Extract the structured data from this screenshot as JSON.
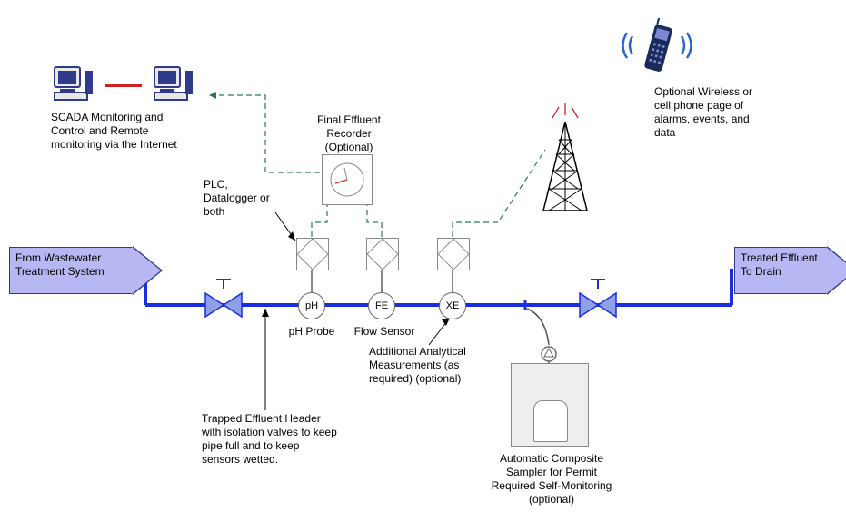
{
  "input_label": "From Wastewater\nTreatment System",
  "output_label": "Treated Effluent\nTo Drain",
  "recorder": {
    "title": "Final Effluent\nRecorder",
    "subtitle": "(Optional)"
  },
  "scada_label": "SCADA Monitoring and\nControl and Remote\nmonitoring via the Internet",
  "wireless_label": "Optional Wireless or\ncell phone page of\nalarms, events, and\ndata",
  "plc_label": "PLC,\nDatalogger or\nboth",
  "sensors": {
    "ph": {
      "code": "pH",
      "label": "pH Probe"
    },
    "fe": {
      "code": "FE",
      "label": "Flow Sensor"
    },
    "xe": {
      "code": "XE",
      "label": "Additional Analytical\nMeasurements (as\nrequired) (optional)"
    }
  },
  "header_label": "Trapped Effluent Header\nwith isolation valves to keep\npipe full and to keep\nsensors wetted.",
  "sampler_label": "Automatic Composite\nSampler for Permit\nRequired Self-Monitoring\n(optional)"
}
